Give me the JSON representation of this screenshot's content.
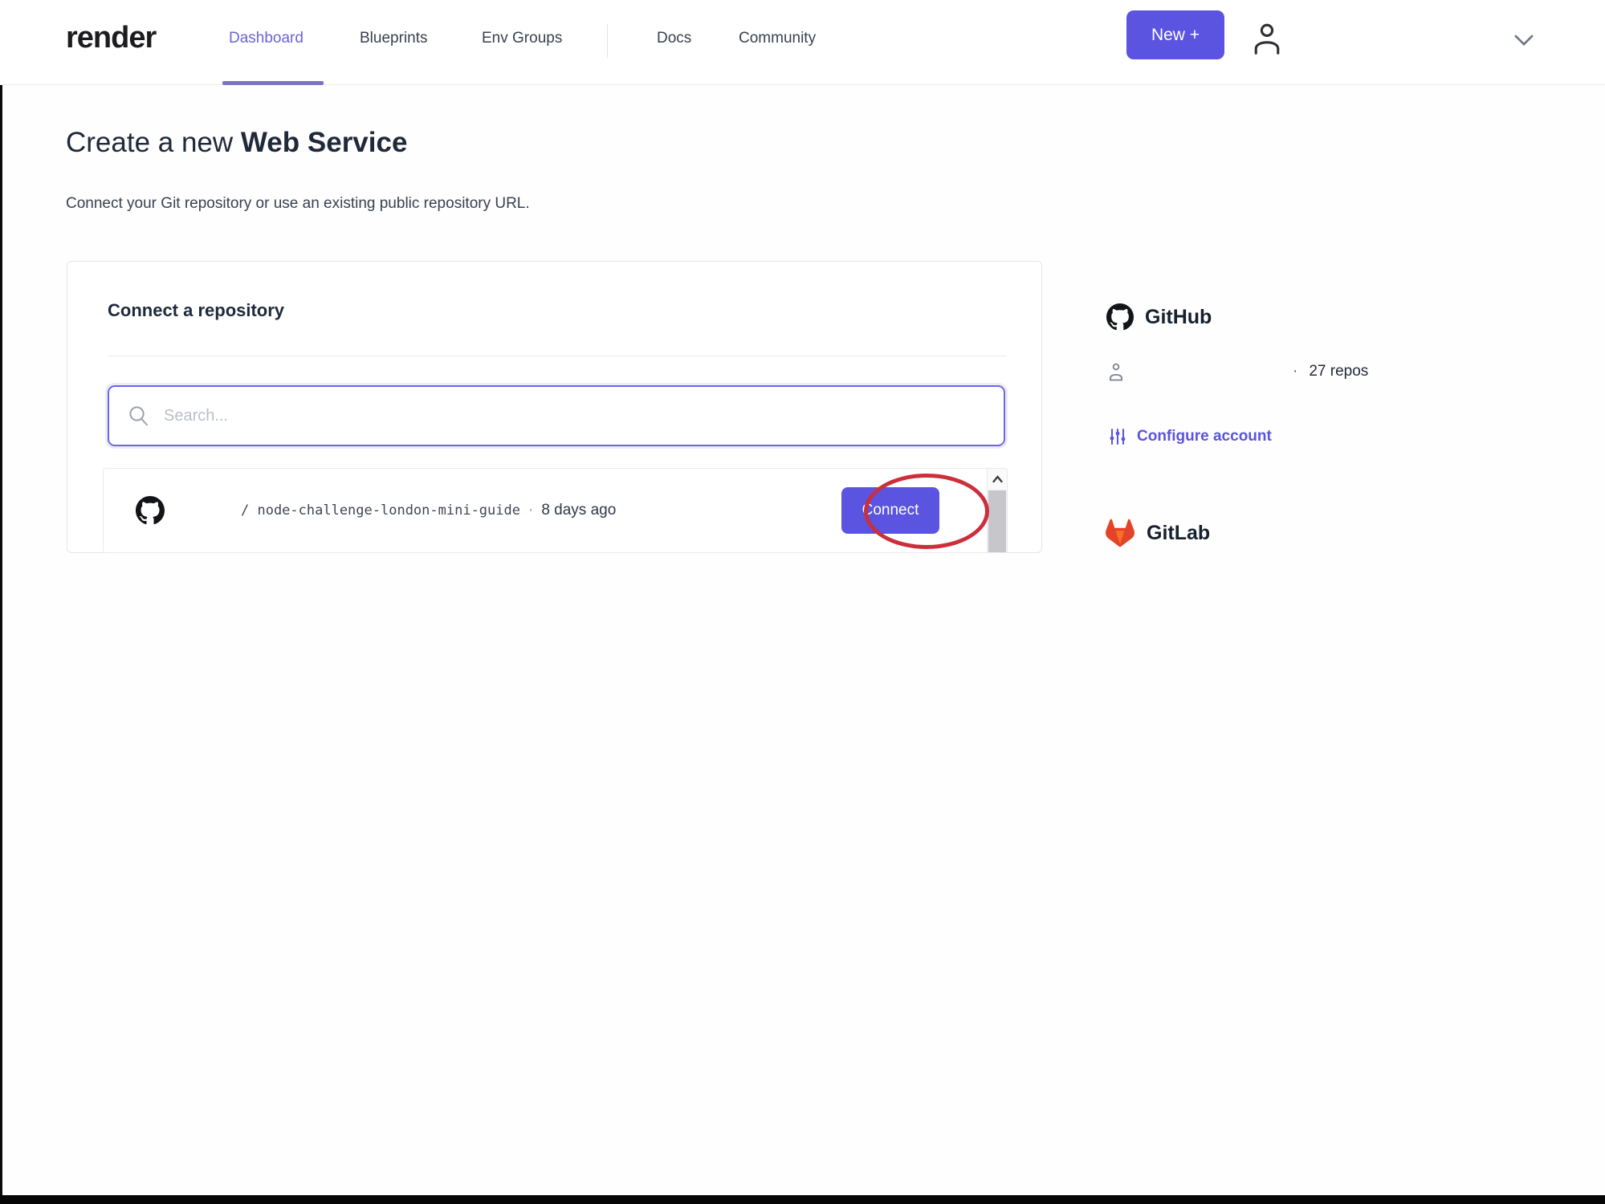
{
  "colors": {
    "accent": "#5a54e0",
    "accent_underline": "#7b73c7",
    "link": "#5a54e0",
    "annotation_red": "#cb2f3c",
    "gitlab_orange": "#e24329",
    "text_dark": "#1e2736",
    "text_nav": "#3a4150",
    "placeholder": "#b9bfca"
  },
  "nav": {
    "logo": "render",
    "items": [
      {
        "label": "Dashboard",
        "active": true
      },
      {
        "label": "Blueprints",
        "active": false
      },
      {
        "label": "Env Groups",
        "active": false
      },
      {
        "label": "Docs",
        "active": false
      },
      {
        "label": "Community",
        "active": false
      }
    ],
    "new_button_label": "New +"
  },
  "page": {
    "title_prefix": "Create a new ",
    "title_emphasis": "Web Service",
    "subtitle": "Connect your Git repository or use an existing public repository URL."
  },
  "connect_card": {
    "heading": "Connect a repository",
    "search_placeholder": "Search...",
    "repo_row": {
      "path": "/ node-challenge-london-mini-guide",
      "separator": "·",
      "updated": "8 days ago",
      "connect_label": "Connect"
    }
  },
  "sidebar": {
    "github": {
      "title": "GitHub",
      "separator": "·",
      "repo_count": "27 repos",
      "configure_label": "Configure account"
    },
    "gitlab": {
      "title": "GitLab"
    }
  }
}
